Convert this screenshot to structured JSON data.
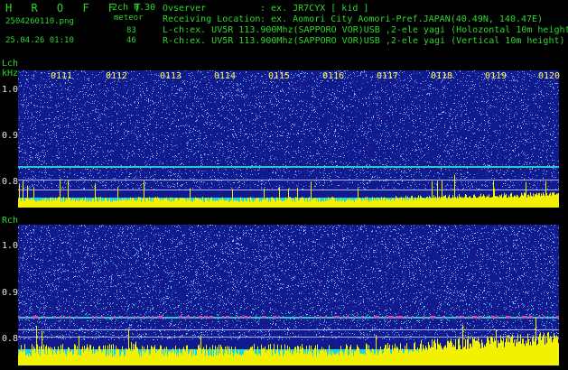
{
  "header": {
    "app_name": "H R O F F T",
    "mode": "2ch 0.30",
    "filename": "2504260110.png",
    "detection_label": "meteor",
    "datetime": "25.04.26 01:10",
    "l_count": "83",
    "r_count": "46",
    "observer_label": "Ovserver",
    "observer_value": ": ex. JR7CYX [ kid ]",
    "location_label": "Receiving Location",
    "location_value": ": ex. Aomori City Aomori-Pref.JAPAN(40.49N, 140.47E)",
    "lch_info": "L-ch:ex. UV5R 113.900Mhz(SAPPORO VOR)USB ,2-ele yagi (Holozontal 10m height)",
    "rch_info": "R-ch:ex. UV5R 113.900Mhz(SAPPORO VOR)USB ,2-ele yagi (Vertical 10m height)"
  },
  "lch": {
    "label": "Lch",
    "unit": "kHz",
    "y_ticks": [
      "1.0",
      "0.9",
      "0.8"
    ],
    "time_ticks": [
      "0111",
      "0112",
      "0113",
      "0114",
      "0115",
      "0116",
      "0117",
      "0118",
      "0119",
      "0120"
    ]
  },
  "rch": {
    "label": "Rch",
    "y_ticks": [
      "1.0",
      "0.9",
      "0.8"
    ]
  },
  "colors": {
    "noise_bg": "#101a8c",
    "signal_band": "#27c9c9",
    "level_bars": "#f2f200",
    "level_base": "#19d7e0",
    "header_green": "#2fd62f"
  }
}
